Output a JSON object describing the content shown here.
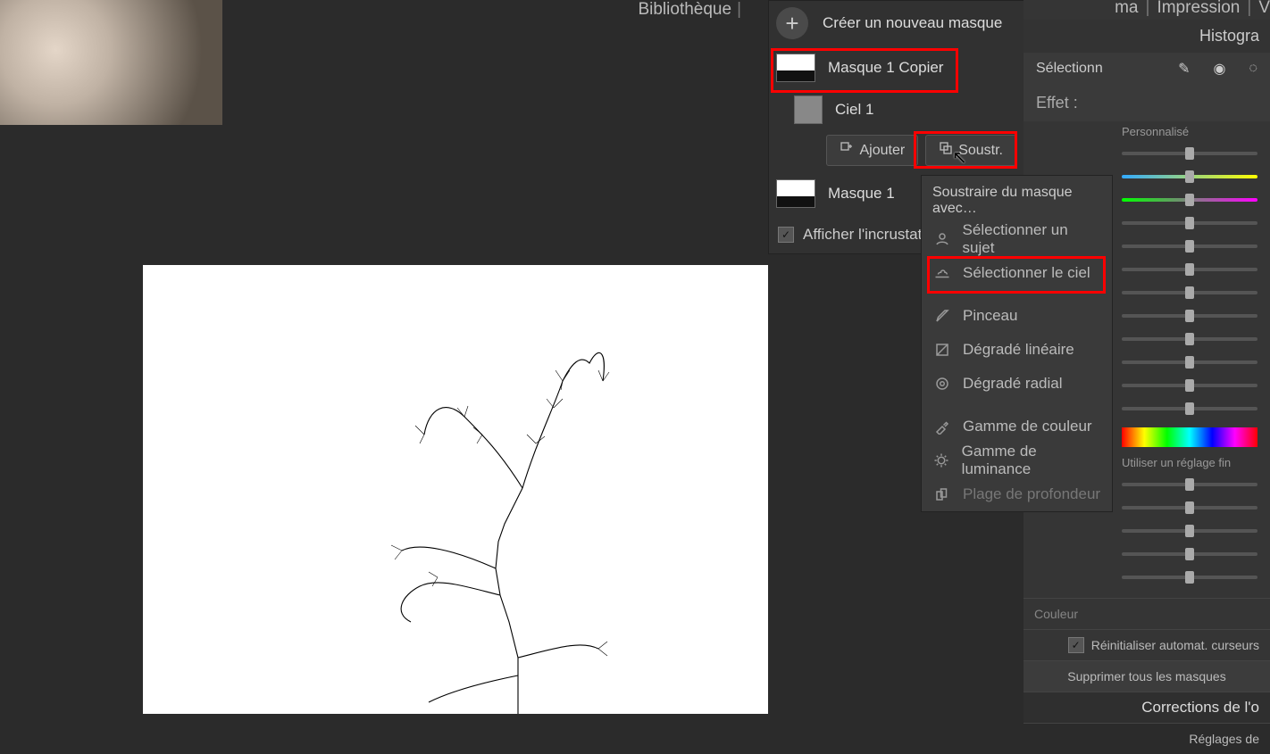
{
  "topbar": {
    "lib": "Bibliothèque",
    "rama": "ma",
    "impr": "Impression",
    "v": "V"
  },
  "maskPanel": {
    "newMask": "Créer un nouveau masque",
    "mask1copy": "Masque 1 Copier",
    "sky1": "Ciel 1",
    "add": "Ajouter",
    "sub": "Soustr.",
    "mask1": "Masque 1",
    "overlay": "Afficher l'incrustati"
  },
  "dropdown": {
    "header": "Soustraire du masque avec…",
    "subject": "Sélectionner un sujet",
    "sky": "Sélectionner le ciel",
    "brush": "Pinceau",
    "linGrad": "Dégradé linéaire",
    "radGrad": "Dégradé radial",
    "colorRange": "Gamme de couleur",
    "lumRange": "Gamme de luminance",
    "depthRange": "Plage de profondeur"
  },
  "right": {
    "histo": "Histogra",
    "select": "Sélectionn",
    "effect": "Effet :",
    "custom": "Personnalisé",
    "fine": "Utiliser un réglage fin",
    "couleur": "Couleur",
    "resetAuto": "Réinitialiser automat. curseurs",
    "delAll": "Supprimer tous les masques",
    "corr": "Corrections de l'o",
    "settings": "Réglages de"
  },
  "chart_data": null
}
